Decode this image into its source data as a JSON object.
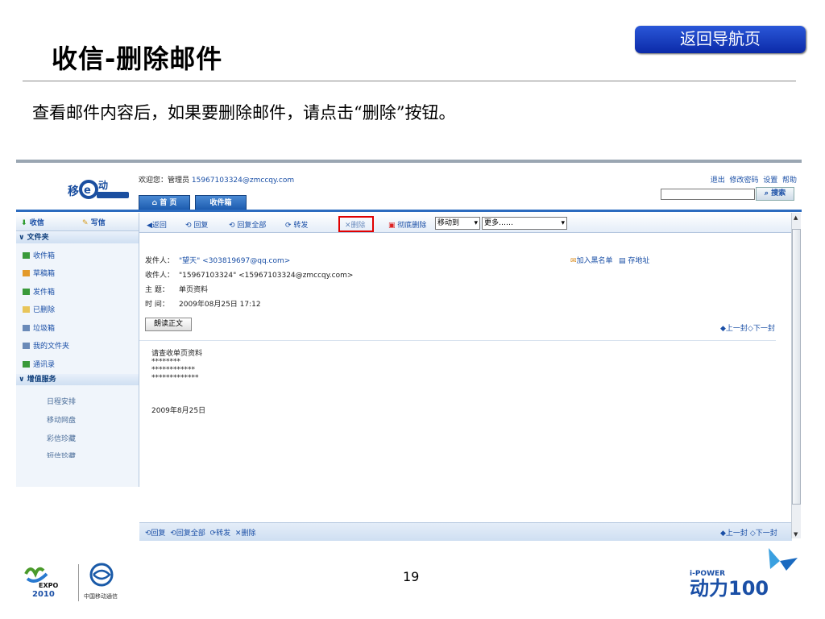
{
  "slide": {
    "title": "收信-删除邮件",
    "nav_button": "返回导航页",
    "description": "查看邮件内容后，如果要删除邮件，请点击“删除”按钮。",
    "page_number": "19"
  },
  "mail": {
    "welcome_prefix": "欢迎您：管理员",
    "welcome_email": "15967103324@zmccqy.com",
    "top_links": [
      "退出",
      "修改密码",
      "设置",
      "帮助"
    ],
    "search_button": "搜索",
    "tabs": [
      "首 页",
      "收件箱"
    ],
    "compose": {
      "receive": "收信",
      "write": "写信"
    },
    "sidebar": {
      "folder_section": "文件夹",
      "folders": [
        "收件箱",
        "草稿箱",
        "发件箱",
        "已删除",
        "垃圾箱",
        "我的文件夹",
        "通讯录"
      ],
      "value_section": "增值服务",
      "services": [
        "日程安排",
        "移动网盘",
        "彩信珍藏",
        "短信珍藏"
      ]
    },
    "toolbar": {
      "back": "返回",
      "reply": "回复",
      "reply_all": "回复全部",
      "forward": "转发",
      "delete": "删除",
      "perm_delete": "彻底删除",
      "move_to": "移动到",
      "more": "更多……"
    },
    "message": {
      "from_label": "发件人：",
      "from_name": "\"望天\"",
      "from_addr": "<303819697@qq.com>",
      "to_label": "收件人：",
      "to": "\"15967103324\" <15967103324@zmccqy.com>",
      "subject_label": "主  题：",
      "subject": "单页资料",
      "time_label": "时  间：",
      "time": "2009年08月25日 17:12",
      "blacklist": "加入黑名单",
      "save_address": "存地址",
      "read_aloud": "朗读正文",
      "prev": "上一封",
      "next": "下一封",
      "body_lines": [
        "请查收单页资料",
        "********",
        "************",
        "*************"
      ],
      "body_date": "2009年8月25日"
    }
  },
  "footer": {
    "expo_text": "EXPO",
    "expo_year": "2010",
    "cm_text": "中国移动通信",
    "ipower": "i-POWER",
    "ipower_brand": "动力100"
  }
}
